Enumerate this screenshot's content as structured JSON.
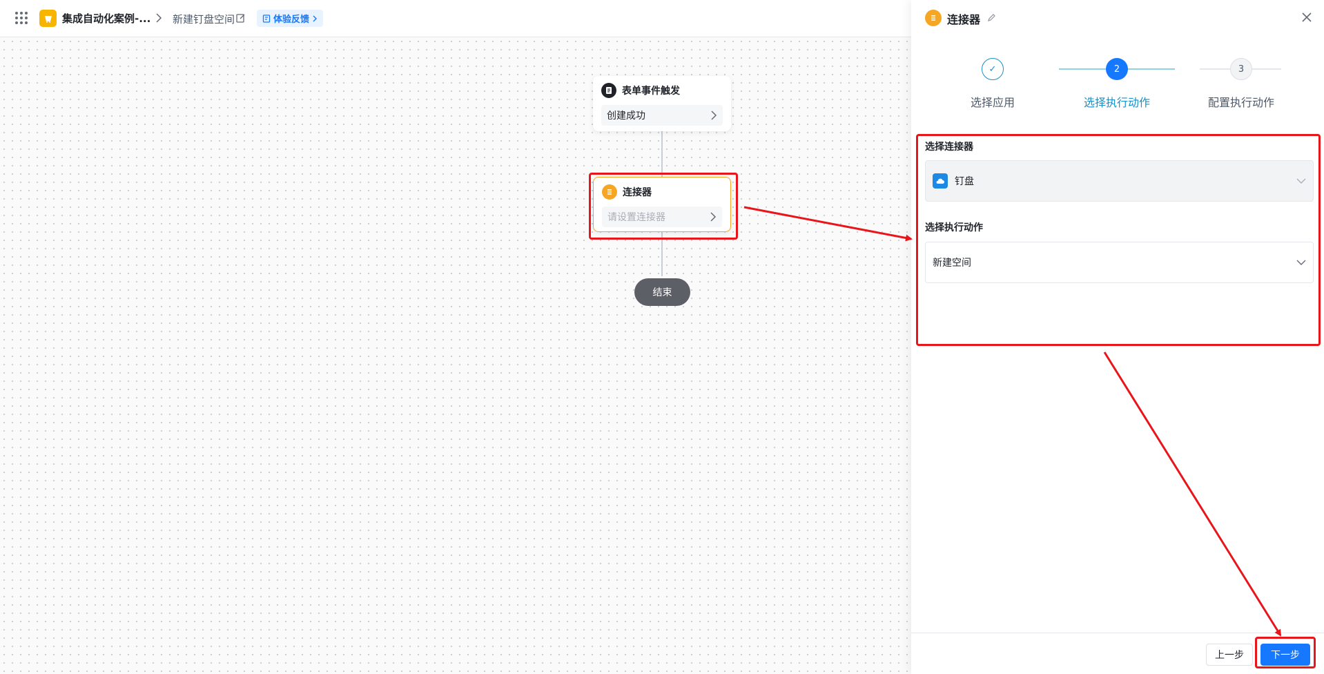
{
  "header": {
    "app_name": "集成自动化案例-...",
    "page_name": "新建钉盘空间",
    "feedback_label": "体验反馈"
  },
  "canvas": {
    "trigger_node": {
      "title": "表单事件触发",
      "value": "创建成功"
    },
    "connector_node": {
      "title": "连接器",
      "placeholder": "请设置连接器"
    },
    "end_node": {
      "label": "结束"
    }
  },
  "panel": {
    "title": "连接器",
    "steps": [
      {
        "number": "✓",
        "label": "选择应用",
        "state": "done"
      },
      {
        "number": "2",
        "label": "选择执行动作",
        "state": "active"
      },
      {
        "number": "3",
        "label": "配置执行动作",
        "state": "pending"
      }
    ],
    "connector_field": {
      "label": "选择连接器",
      "value": "钉盘"
    },
    "action_field": {
      "label": "选择执行动作",
      "value": "新建空间"
    },
    "footer": {
      "prev_label": "上一步",
      "next_label": "下一步"
    }
  },
  "colors": {
    "accent": "#1677ff",
    "highlight": "#e8151b",
    "connector_orange": "#f5a623",
    "app_logo_yellow": "#f7b500"
  }
}
